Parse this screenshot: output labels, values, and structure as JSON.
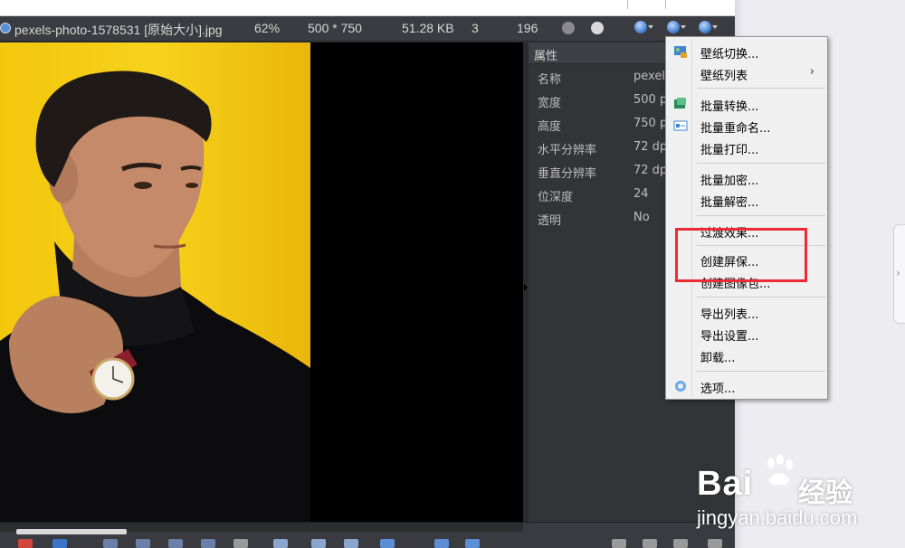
{
  "infobar": {
    "filename": "pexels-photo-1578531 [原始大小].jpg",
    "zoom": "62%",
    "dimensions": "500 * 750",
    "filesize": "51.28 KB",
    "index": "3",
    "total": "196"
  },
  "properties": {
    "title": "属性",
    "rows": [
      {
        "key": "名称",
        "value": "pexel"
      },
      {
        "key": "宽度",
        "value": "500 p"
      },
      {
        "key": "高度",
        "value": "750 p"
      },
      {
        "key": "水平分辨率",
        "value": "72 dp"
      },
      {
        "key": "垂直分辨率",
        "value": "72 dp"
      },
      {
        "key": "位深度",
        "value": "24"
      },
      {
        "key": "透明",
        "value": "No"
      }
    ]
  },
  "menu": {
    "items": [
      {
        "label": "壁纸切换...",
        "icon": "wallpaper-icon"
      },
      {
        "label": "壁纸列表",
        "submenu": "›"
      },
      {
        "label": "批量转换...",
        "icon": "batch-convert-icon"
      },
      {
        "label": "批量重命名...",
        "icon": "batch-rename-icon"
      },
      {
        "label": "批量打印..."
      },
      {
        "label": "批量加密..."
      },
      {
        "label": "批量解密..."
      },
      {
        "label": "过渡效果..."
      },
      {
        "label": "创建屏保..."
      },
      {
        "label": "创建图像包..."
      },
      {
        "label": "导出列表..."
      },
      {
        "label": "导出设置..."
      },
      {
        "label": "卸载..."
      },
      {
        "label": "选项...",
        "icon": "options-icon"
      }
    ]
  },
  "watermark": {
    "brand_left": "Bai",
    "brand_right": "经验",
    "url": "jingyan.baidu.com"
  },
  "colors": {
    "highlight": "#ee2a36",
    "photo_bg": "#f3c70c",
    "panel_bg": "#333438"
  }
}
